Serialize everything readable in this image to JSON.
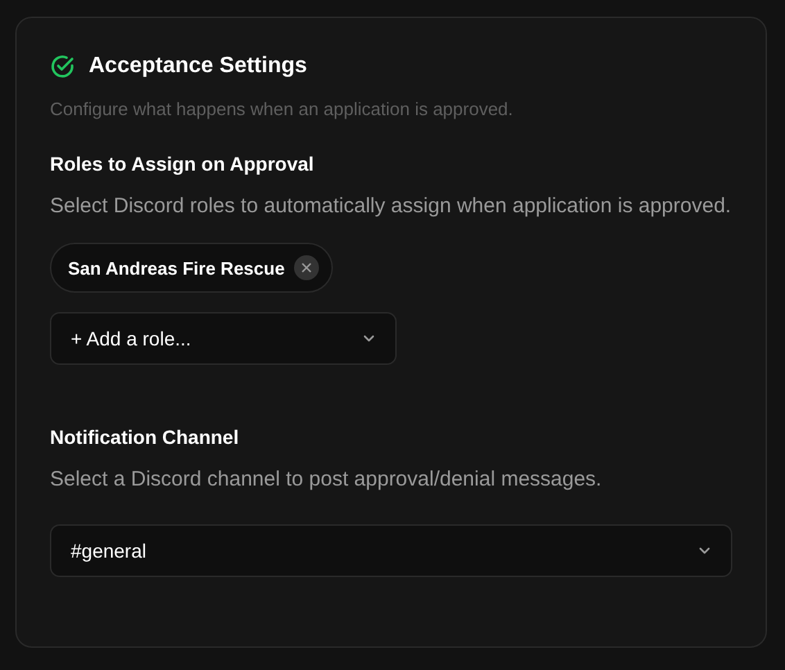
{
  "title": "Acceptance Settings",
  "subtitle": "Configure what happens when an application is approved.",
  "roles": {
    "heading": "Roles to Assign on Approval",
    "description": "Select Discord roles to automatically assign when application is approved.",
    "chips": [
      {
        "label": "San Andreas Fire Rescue"
      }
    ],
    "add_select": {
      "value": "+ Add a role..."
    }
  },
  "notification": {
    "heading": "Notification Channel",
    "description": "Select a Discord channel to post approval/denial messages.",
    "select": {
      "value": "#general"
    }
  }
}
